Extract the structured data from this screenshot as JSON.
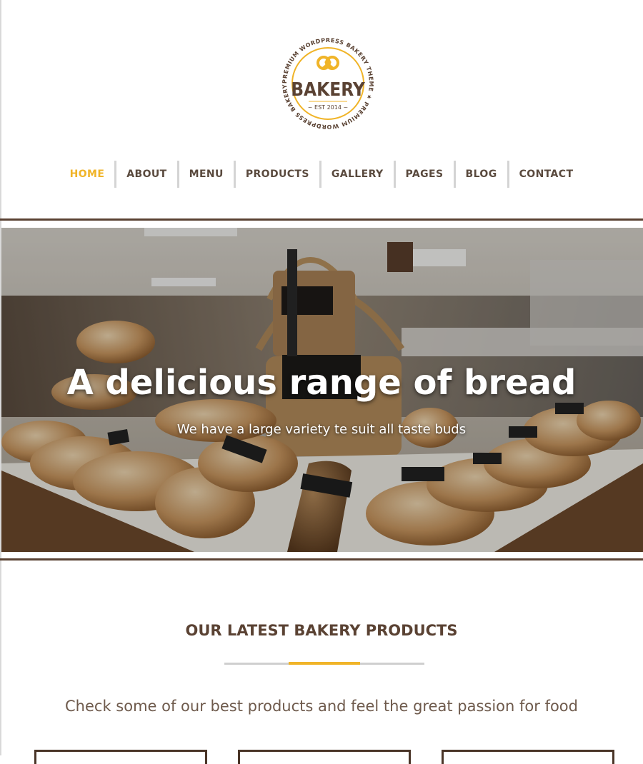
{
  "logo": {
    "name": "BAKERY",
    "est": "~ EST 2014 ~",
    "ring_text": "PREMIUM WORDPRESS BAKERY THEME ★ PREMIUM WORDPRESS BAKERY THEME ★"
  },
  "nav": {
    "items": [
      {
        "label": "HOME"
      },
      {
        "label": "ABOUT"
      },
      {
        "label": "MENU"
      },
      {
        "label": "PRODUCTS"
      },
      {
        "label": "GALLERY"
      },
      {
        "label": "PAGES"
      },
      {
        "label": "BLOG"
      },
      {
        "label": "CONTACT"
      }
    ],
    "active": "HOME"
  },
  "hero": {
    "title": "A delicious range of bread",
    "subtitle": "We have a large variety te suit all taste buds",
    "signs": [
      "Parisienne",
      "White"
    ]
  },
  "section": {
    "title": "OUR LATEST BAKERY PRODUCTS",
    "subtitle": "Check some of our best products and feel the great passion for food"
  },
  "colors": {
    "accent": "#f0b428",
    "brown": "#5a4233",
    "text": "#5a4a3e"
  }
}
